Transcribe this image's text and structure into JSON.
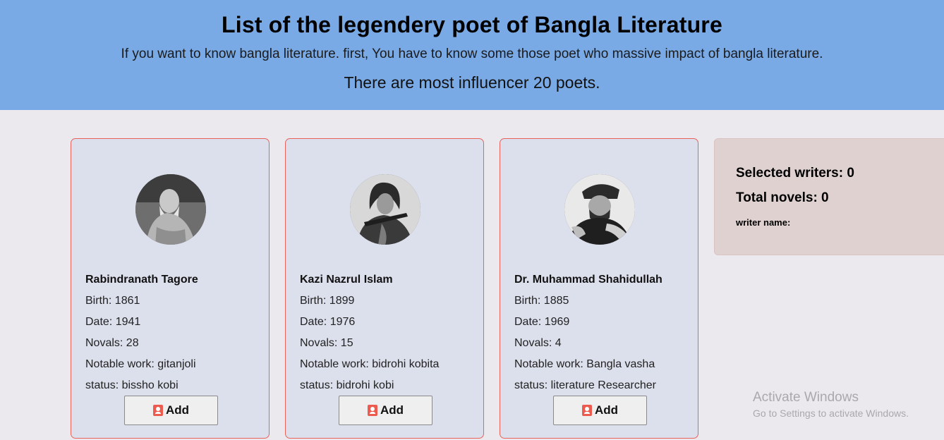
{
  "header": {
    "title": "List of the legendery poet of Bangla Literature",
    "subtitle": "If you want to know bangla literature. first, You have to know some those poet who massive impact of bangla literature.",
    "count_text": "There are most influencer 20 poets."
  },
  "cards": [
    {
      "name": "Rabindranath Tagore",
      "birth": "Birth: 1861",
      "date": "Date: 1941",
      "novels": "Novals: 28",
      "notable": "Notable work: gitanjoli",
      "status": "status: bissho kobi",
      "button_label": "Add",
      "avatar_icon": "portrait-photo"
    },
    {
      "name": "Kazi Nazrul Islam",
      "birth": "Birth: 1899",
      "date": "Date: 1976",
      "novels": "Novals: 15",
      "notable": "Notable work: bidrohi kobita",
      "status": "status: bidrohi kobi",
      "button_label": "Add",
      "avatar_icon": "portrait-photo"
    },
    {
      "name": "Dr. Muhammad Shahidullah",
      "birth": "Birth: 1885",
      "date": "Date: 1969",
      "novels": "Novals: 4",
      "notable": "Notable work: Bangla vasha",
      "status": "status: literature Researcher",
      "button_label": "Add",
      "avatar_icon": "portrait-photo"
    }
  ],
  "summary": {
    "selected": "Selected writers: 0",
    "total": "Total novels: 0",
    "writer_name": "writer name:"
  },
  "watermark": {
    "line1": "Activate Windows",
    "line2": "Go to Settings to activate Windows."
  },
  "colors": {
    "header_bg": "#7aaae6",
    "page_bg": "#ebe8ee",
    "card_bg": "#dcdfec",
    "card_border": "#e8625a",
    "summary_bg": "#e0d1d1",
    "button_icon": "#ec5b4e"
  }
}
